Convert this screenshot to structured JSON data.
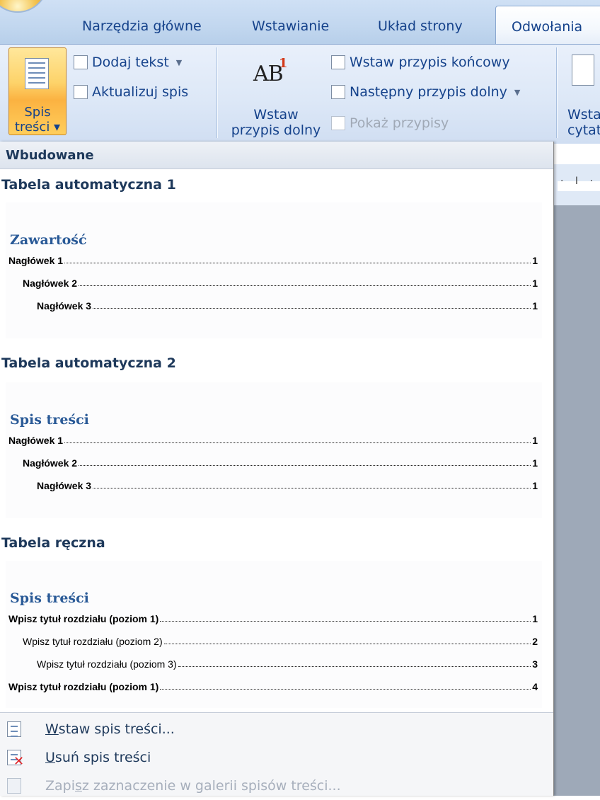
{
  "tabs": {
    "home": "Narzędzia główne",
    "insert": "Wstawianie",
    "layout": "Układ strony",
    "references": "Odwołania"
  },
  "ribbon": {
    "toc_button": {
      "line1": "Spis",
      "line2": "treści ▾"
    },
    "add_text": "Dodaj tekst",
    "update_toc": "Aktualizuj spis",
    "insert_footnote": {
      "line1": "Wstaw",
      "line2": "przypis dolny",
      "glyph": "AB",
      "sup": "1"
    },
    "insert_endnote": "Wstaw przypis końcowy",
    "next_footnote": "Następny przypis dolny",
    "show_notes": "Pokaż przypisy",
    "insert_citation": {
      "line1": "Wsta",
      "line2": "cytat"
    }
  },
  "ruler": {
    "ticks": "· I ·"
  },
  "gallery": {
    "section_title": "Wbudowane",
    "items": [
      {
        "title": "Tabela automatyczna 1",
        "heading": "Zawartość",
        "rows": [
          {
            "label": "Nagłówek 1",
            "page": "1"
          },
          {
            "label": "Nagłówek 2",
            "page": "1"
          },
          {
            "label": "Nagłówek 3",
            "page": "1"
          }
        ]
      },
      {
        "title": "Tabela automatyczna 2",
        "heading": "Spis treści",
        "rows": [
          {
            "label": "Nagłówek 1",
            "page": "1"
          },
          {
            "label": "Nagłówek 2",
            "page": "1"
          },
          {
            "label": "Nagłówek 3",
            "page": "1"
          }
        ]
      },
      {
        "title": "Tabela ręczna",
        "heading": "Spis treści",
        "rows": [
          {
            "label": "Wpisz tytuł rozdziału (poziom 1)",
            "page": "1"
          },
          {
            "label": "Wpisz tytuł rozdziału (poziom 2)",
            "page": "2"
          },
          {
            "label": "Wpisz tytuł rozdziału (poziom 3)",
            "page": "3"
          },
          {
            "label": "Wpisz tytuł rozdziału (poziom 1)",
            "page": "4"
          }
        ]
      }
    ]
  },
  "menu": {
    "insert_toc": {
      "mnemonic": "W",
      "rest": "staw spis treści..."
    },
    "remove_toc": {
      "mnemonic": "U",
      "rest": "suń spis treści"
    },
    "save_selection": {
      "before": "Zapi",
      "mnemonic": "s",
      "rest": "z zaznaczenie w galerii spisów treści..."
    }
  },
  "icons": {
    "office_button": "office-logo-icon",
    "toc": "document-lines-icon",
    "add_text": "add-text-icon",
    "update": "update-table-icon",
    "endnote": "endnote-icon",
    "next_footnote": "next-footnote-icon",
    "show_notes": "show-notes-icon",
    "citation": "citation-icon",
    "remove": "remove-toc-icon"
  },
  "colors": {
    "accent_orange": "#fbb241",
    "ribbon_text": "#15428b",
    "heading_blue": "#2a5a97",
    "remove_red": "#e0262a"
  }
}
